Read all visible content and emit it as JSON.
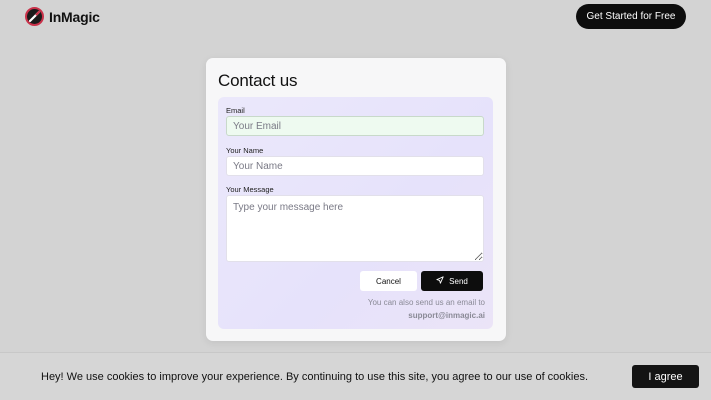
{
  "header": {
    "brand": "InMagic",
    "cta_label": "Get Started for Free"
  },
  "contact": {
    "title": "Contact us",
    "email_label": "Email",
    "email_placeholder": "Your Email",
    "name_label": "Your Name",
    "name_placeholder": "Your Name",
    "message_label": "Your Message",
    "message_placeholder": "Type your message here",
    "cancel_label": "Cancel",
    "send_label": "Send",
    "note_prefix": "You can also send us an email to",
    "note_email": "support@inmagic.ai"
  },
  "cookie": {
    "text": "Hey! We use cookies to improve your experience. By continuing to use this site, you agree to our use of cookies.",
    "agree_label": "I agree"
  },
  "colors": {
    "background": "#d3d3d3",
    "accent_dark": "#0d0d0d",
    "form_tint": "#e8e5fb",
    "logo_ring": "#c9324a"
  },
  "icons": {
    "logo": "wand-icon",
    "send": "paper-plane-icon"
  }
}
